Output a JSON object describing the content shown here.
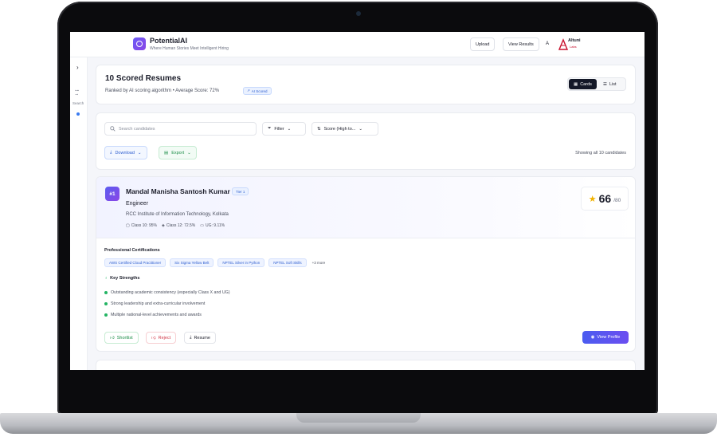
{
  "header": {
    "brand_name": "PotentialAI",
    "brand_tagline": "Where Human Stories Meet Intelligent Hiring",
    "upload_label": "Upload",
    "view_results_label": "View Results",
    "avatar_initial": "A",
    "partner_logo_text": "Altuni",
    "partner_logo_sub": "Labs"
  },
  "sidebar": {
    "search_label": "Search"
  },
  "summary": {
    "title": "10 Scored Resumes",
    "subtitle": "Ranked by AI scoring algorithm • Average Score: 72%",
    "badge": "AI Scored",
    "view_cards_label": "Cards",
    "view_list_label": "List"
  },
  "toolbar": {
    "search_placeholder": "Search candidates",
    "filter_label": "Filter",
    "sort_label": "Score (High to...",
    "download_label": "Download",
    "export_label": "Export",
    "showing_text": "Showing all 10 candidates"
  },
  "candidate": {
    "rank": "#1",
    "name": "Mandal Manisha Santosh Kumar",
    "tier": "Tier 1",
    "role": "Engineer",
    "institute": "RCC Institute of Information Technology, Kolkata",
    "class10": "Class 10: 95%",
    "class12": "Class 12: 72.5%",
    "ug": "UG: 9.11%",
    "score": "66",
    "score_max": "/80",
    "certifications_title": "Professional Certifications",
    "certifications": [
      "AWS Certified Cloud Practitioner",
      "Six Sigma Yellow Belt",
      "NPTEL Silver in Python",
      "NPTEL Soft Skills"
    ],
    "cert_more": "+3 more",
    "strengths_title": "Key Strengths",
    "strengths": [
      "Outstanding academic consistency (especially Class X and UG)",
      "Strong leadership and extra-curricular involvement",
      "Multiple national-level achievements and awards"
    ],
    "shortlist_label": "Shortlist",
    "reject_label": "Reject",
    "resume_label": "Resume",
    "view_profile_label": "View Profile"
  }
}
